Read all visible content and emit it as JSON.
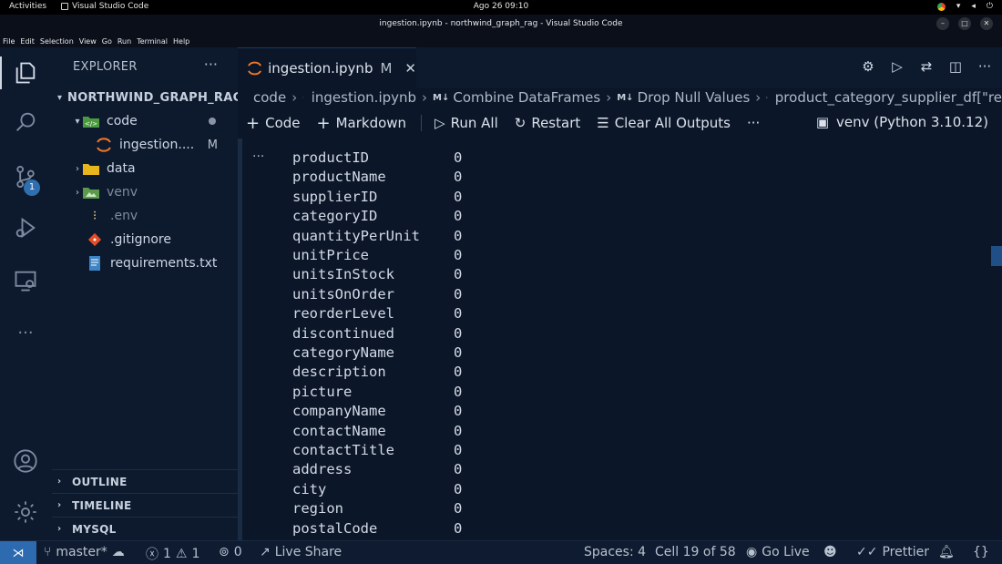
{
  "system": {
    "activities": "Activities",
    "app_name": "Visual Studio Code",
    "clock": "Ago 26  09:10"
  },
  "window": {
    "title": "ingestion.ipynb - northwind_graph_rag - Visual Studio Code"
  },
  "menu": [
    "File",
    "Edit",
    "Selection",
    "View",
    "Go",
    "Run",
    "Terminal",
    "Help"
  ],
  "activity_bar": {
    "source_control_badge": "1"
  },
  "explorer": {
    "header": "EXPLORER",
    "more": "···",
    "project": "NORTHWIND_GRAPH_RAG",
    "items": [
      {
        "label": "code",
        "icon": "folder-code-icon"
      },
      {
        "label": "ingestion.ipynb",
        "display": "ingestion....",
        "icon": "jupyter-icon",
        "status": "M"
      },
      {
        "label": "data",
        "icon": "folder-icon"
      },
      {
        "label": "venv",
        "icon": "folder-venv-icon"
      },
      {
        "label": ".env",
        "icon": "env-icon"
      },
      {
        "label": ".gitignore",
        "icon": "git-icon"
      },
      {
        "label": "requirements.txt",
        "icon": "text-file-icon"
      }
    ],
    "sections": [
      "OUTLINE",
      "TIMELINE",
      "MYSQL"
    ]
  },
  "tab": {
    "label": "ingestion.ipynb",
    "status": "M",
    "close": "✕"
  },
  "breadcrumb": {
    "folder": "code",
    "file": "ingestion.ipynb",
    "md1": "Combine DataFrames",
    "md2": "Drop Null Values",
    "symbol": "product_category_supplier_df[\"re"
  },
  "notebook_toolbar": {
    "code": "Code",
    "markdown": "Markdown",
    "run_all": "Run All",
    "restart": "Restart",
    "clear": "Clear All Outputs",
    "more": "···",
    "kernel": "venv (Python 3.10.12)"
  },
  "output": {
    "ellipsis": "···",
    "rows": [
      {
        "name": "productID",
        "value": "0"
      },
      {
        "name": "productName",
        "value": "0"
      },
      {
        "name": "supplierID",
        "value": "0"
      },
      {
        "name": "categoryID",
        "value": "0"
      },
      {
        "name": "quantityPerUnit",
        "value": "0"
      },
      {
        "name": "unitPrice",
        "value": "0"
      },
      {
        "name": "unitsInStock",
        "value": "0"
      },
      {
        "name": "unitsOnOrder",
        "value": "0"
      },
      {
        "name": "reorderLevel",
        "value": "0"
      },
      {
        "name": "discontinued",
        "value": "0"
      },
      {
        "name": "categoryName",
        "value": "0"
      },
      {
        "name": "description",
        "value": "0"
      },
      {
        "name": "picture",
        "value": "0"
      },
      {
        "name": "companyName",
        "value": "0"
      },
      {
        "name": "contactName",
        "value": "0"
      },
      {
        "name": "contactTitle",
        "value": "0"
      },
      {
        "name": "address",
        "value": "0"
      },
      {
        "name": "city",
        "value": "0"
      },
      {
        "name": "region",
        "value": "0"
      },
      {
        "name": "postalCode",
        "value": "0"
      }
    ]
  },
  "status_bar": {
    "branch": "master*",
    "errors": "1",
    "warnings": "1",
    "ports": "0",
    "live_share": "Live Share",
    "spaces": "Spaces: 4",
    "cell": "Cell 19 of 58",
    "go_live": "Go Live",
    "prettier": "Prettier"
  },
  "colors": {
    "background": "#0b1628",
    "sidebar": "#0d1a2e",
    "remote_indicator": "#2d6ab0",
    "jupyter_orange": "#f37726"
  }
}
